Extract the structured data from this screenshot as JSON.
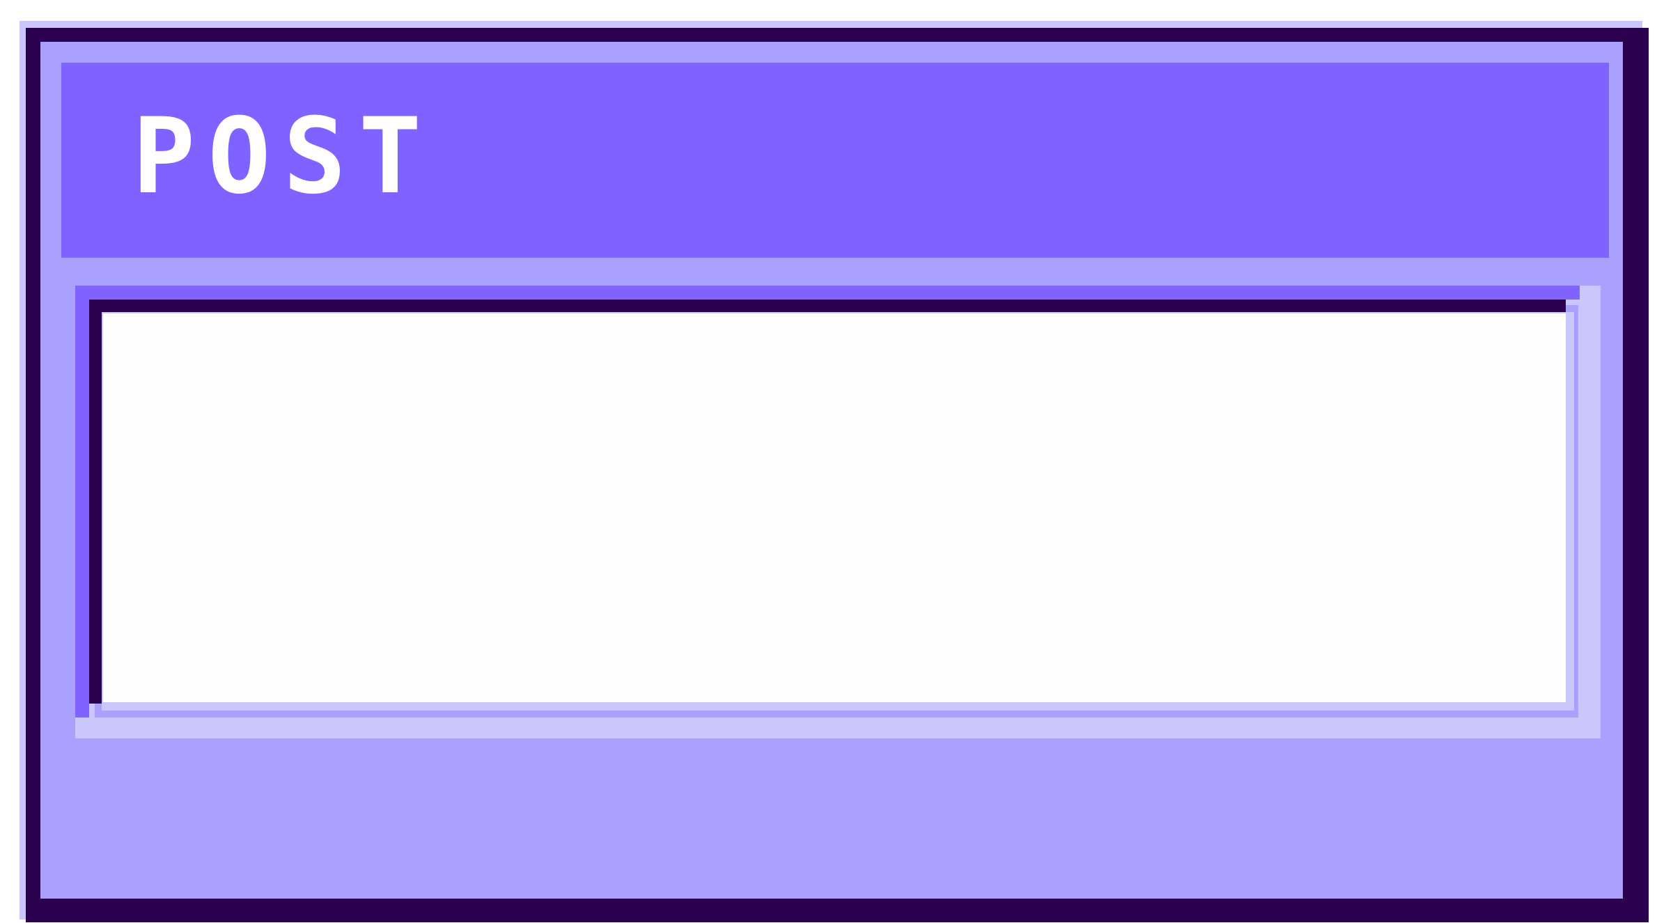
{
  "window": {
    "title": "POST"
  },
  "post_input": {
    "value": "",
    "placeholder": ""
  },
  "colors": {
    "light": "#c8c6fb",
    "body": "#a99ffd",
    "accent": "#7f62ff",
    "dark": "#2b004f",
    "text": "#ffffff",
    "input_bg": "#fefefe"
  }
}
